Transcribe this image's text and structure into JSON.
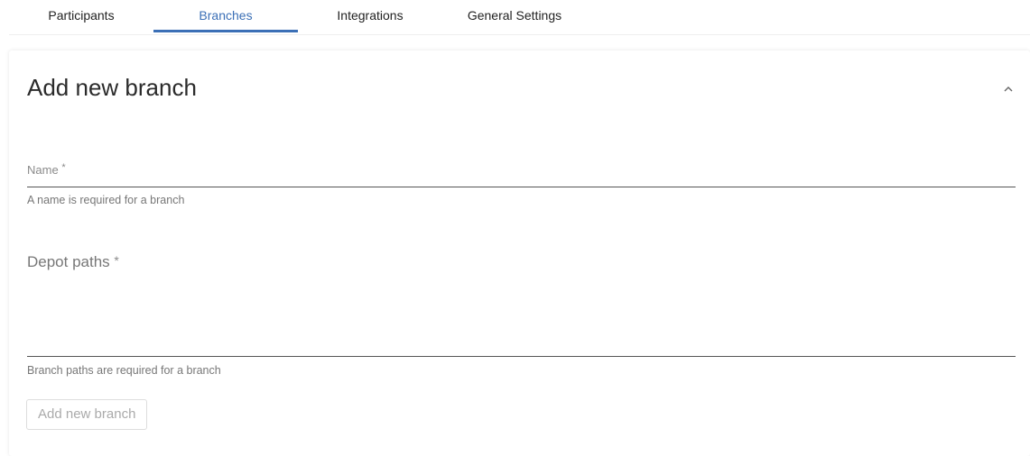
{
  "tabs": [
    {
      "label": "Participants",
      "active": false
    },
    {
      "label": "Branches",
      "active": true
    },
    {
      "label": "Integrations",
      "active": false
    },
    {
      "label": "General Settings",
      "active": false
    }
  ],
  "panel": {
    "title": "Add new branch",
    "collapse_icon": "chevron-up-icon",
    "name_field": {
      "label": "Name",
      "required_mark": "*",
      "value": "",
      "helper": "A name is required for a branch"
    },
    "depot_paths": {
      "label": "Depot paths",
      "required_mark": "*",
      "value": "",
      "helper": "Branch paths are required for a branch"
    },
    "submit_label": "Add new branch",
    "submit_disabled": true
  },
  "colors": {
    "accent": "#3b6fb6",
    "helper_text": "#777777",
    "disabled_text": "#aaaaaa"
  }
}
